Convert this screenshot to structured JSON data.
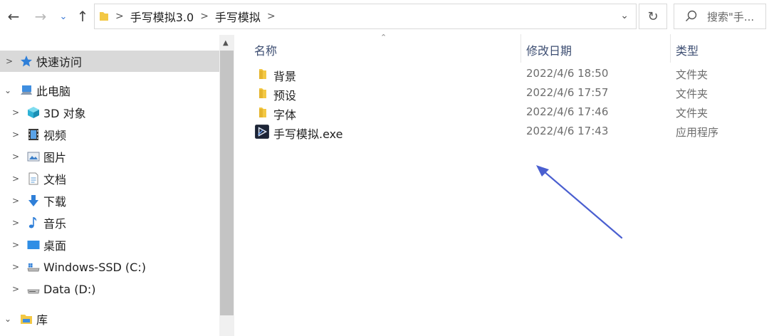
{
  "address": {
    "crumbs": [
      "手写模拟3.0",
      "手写模拟"
    ]
  },
  "search": {
    "placeholder": "搜索\"手..."
  },
  "nav": {
    "items": [
      {
        "label": "快速访问",
        "icon": "star-icon"
      },
      {
        "label": "此电脑",
        "icon": "computer-icon"
      },
      {
        "label": "3D 对象",
        "icon": "cube-3d-icon"
      },
      {
        "label": "视频",
        "icon": "video-icon"
      },
      {
        "label": "图片",
        "icon": "picture-icon"
      },
      {
        "label": "文档",
        "icon": "document-icon"
      },
      {
        "label": "下载",
        "icon": "download-icon"
      },
      {
        "label": "音乐",
        "icon": "music-icon"
      },
      {
        "label": "桌面",
        "icon": "desktop-icon"
      },
      {
        "label": "Windows-SSD (C:)",
        "icon": "system-drive-icon"
      },
      {
        "label": "Data (D:)",
        "icon": "drive-icon"
      },
      {
        "label": "库",
        "icon": "library-icon"
      }
    ]
  },
  "columns": {
    "name": "名称",
    "date": "修改日期",
    "type": "类型"
  },
  "files": [
    {
      "name": "背景",
      "date": "2022/4/6 18:50",
      "type": "文件夹",
      "icon": "folder-icon"
    },
    {
      "name": "预设",
      "date": "2022/4/6 17:57",
      "type": "文件夹",
      "icon": "folder-icon"
    },
    {
      "name": "字体",
      "date": "2022/4/6 17:46",
      "type": "文件夹",
      "icon": "folder-icon"
    },
    {
      "name": "手写模拟.exe",
      "date": "2022/4/6 17:43",
      "type": "应用程序",
      "icon": "app-exe-icon"
    }
  ],
  "colors": {
    "folder": "#f3c845",
    "arrow": "#4a5fd0",
    "selected": "#d9d9d9"
  }
}
